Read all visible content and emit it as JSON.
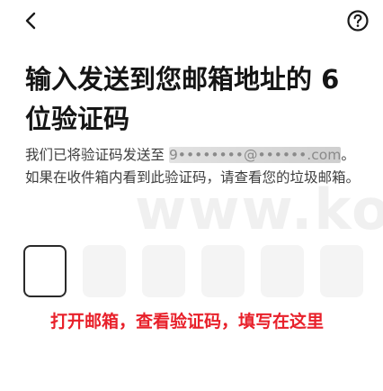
{
  "header": {
    "back_icon": "chevron-left-icon",
    "help_icon": "question-circle-icon"
  },
  "watermark": {
    "text": "www.koopuu.com"
  },
  "title": "输入发送到您邮箱地址的 6 位验证码",
  "description": {
    "before_email": "我们已将验证码发送至 ",
    "email_masked": "9••••••••@••••••.com",
    "after_email": "。如果在收件箱内看到此验证码，请查看您的垃圾邮箱。"
  },
  "code_input": {
    "length": 6,
    "active_index": 0,
    "values": [
      "",
      "",
      "",
      "",
      "",
      ""
    ]
  },
  "annotation": {
    "text": "打开邮箱，查看验证码，填写在这里",
    "color": "#e8202a"
  }
}
